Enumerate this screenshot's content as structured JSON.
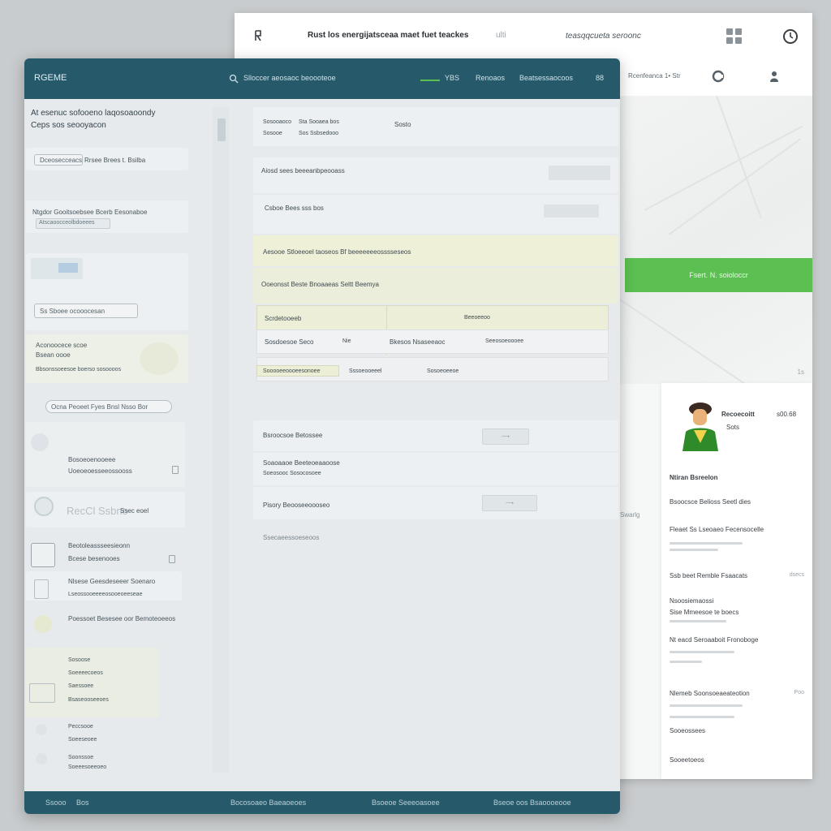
{
  "back_window": {
    "title": "Rust los energijatsceaa maet fuet teackes",
    "title_suffix": "ulti",
    "search_hint": "teasqqcueta seroonc",
    "nav_item": "Rcenfeanca 1• Str",
    "green_banner": "Fsert. N. soioloccr",
    "map_edge_label": "1s",
    "map_side_label": "Swarlg",
    "profile": {
      "name": "Recoecoitt",
      "handle": "Sots",
      "price": "s00.68",
      "section": "Ntiran Bsreelon",
      "rows": [
        "Bsoocsce Belioss Seetl dies",
        "Fleaet Ss Lseoaeo Fecensocelle",
        "Ssb beet Remble Fsaacats",
        "Nsoosiemaossi",
        "Sise Mmeesoe te boecs",
        "Nt eacd Seroaaboit Fronoboge",
        "Nlemeb Soonsoeaeateotion",
        "Sooeossees",
        "Sooeetoeos"
      ],
      "meta": [
        "dsecs",
        "Poo"
      ]
    }
  },
  "front_window": {
    "brand": "RGEME",
    "header_search": "Slloccer aeosaoc beoooteoe",
    "header_links": [
      "YBS",
      "Renoaos",
      "Beatsessaocoos"
    ],
    "header_num": "88",
    "left": {
      "title_line1": "At esenuc sofooeno laqosoaoondy",
      "title_line2": "Ceps sos seooyacon",
      "chip1": "Dceosecceacs",
      "chip1_right": "Rrsee Brees t. Bsilba",
      "tag_label": "Ntgdor Gooitsoebsee Bcerb Eesonaboe",
      "tag_sub": "Atscaoocceolbdoeees",
      "field_value": "Ss Sboee ocooocesan",
      "info_title": "Aconoocece scoe",
      "info_sub": "Bsean oooe",
      "info_link": "Bbsonssoeesoe boerso sosoooos",
      "search_pill": "Ocna Peoeet Fyes Bnsl Nsso Bor",
      "list": [
        {
          "title": "Bosoeoenooeee",
          "sub": "Uoeoeoesseeossooss"
        },
        {
          "title": "RecCl Ssbno",
          "sub": "Ssec eoel"
        },
        {
          "title": "Beotoleassseesieonn",
          "sub": "Bcese besenooes"
        },
        {
          "title": "Nlsese Geesdeseeer Soenaro",
          "sub": "Lseossooeeeeosooeoeeseae"
        },
        {
          "title": "Poessoet Besesee oor Bemoteoeeos",
          "sub": ""
        },
        {
          "title": "Sosoose",
          "sub": "Soeeeecoeos"
        },
        {
          "title": "Saessoee",
          "sub": "Bsaseooseeoes"
        },
        {
          "title": "Peccsooe",
          "sub": "Soeeseoee"
        },
        {
          "title": "Soonssoe",
          "sub": "Soeeesoeeoeo"
        }
      ]
    },
    "main": {
      "filter1": "Sosooaoco",
      "filter1_val": "Sta Sooaea bos",
      "filter2": "Sosooe",
      "filter2_val": "Sos Ssbsedooo",
      "filter_right": "Sosto",
      "row1": "Aiosd sees beeeanbpeooass",
      "row2": "Csboe Bees sss bos",
      "row3": "Aesooe Stloeeoel taoseos Bf beeeeeeeosssseseos",
      "row4": "Ooeonsst Beste Bnoaaeas Seltt Beemya",
      "table_headers": [
        "Scrdetooeeb",
        "Beeoeeoo"
      ],
      "table_row": [
        "Sosdoesoe Seco",
        "Nie",
        "Bkesos Nsaseeaoc",
        "Seeosoeoooee"
      ],
      "table_row2": [
        "Sooooeeoooeesonoee",
        "Sssoeooeeel",
        "Sosoeoeeoe"
      ],
      "item1": "Bsroocsoe Betossee",
      "item2": "Soaoaaoe Beeteoeaaoose",
      "item2_sub": "Soeosooc Sosocosoee",
      "item3": "Pisory Beooseeoooseo",
      "bottom_label": "Ssecaeessoeseoos"
    },
    "footer": [
      "Ssooo",
      "Bos",
      "Bocosoaeo Baeaoeoes",
      "Bsoeoe Seeeoasoee",
      "Bseoe oos Bsaoooeooe"
    ]
  },
  "colors": {
    "header_teal": "#265a6b",
    "green_accent": "#5cbf52",
    "panel_yellow": "#eef0d8"
  },
  "icons": [
    "back-arrow-icon",
    "grid-icon",
    "clock-icon",
    "settings-icon",
    "user-icon",
    "checkbox-icon",
    "search-icon",
    "avatar-person"
  ]
}
